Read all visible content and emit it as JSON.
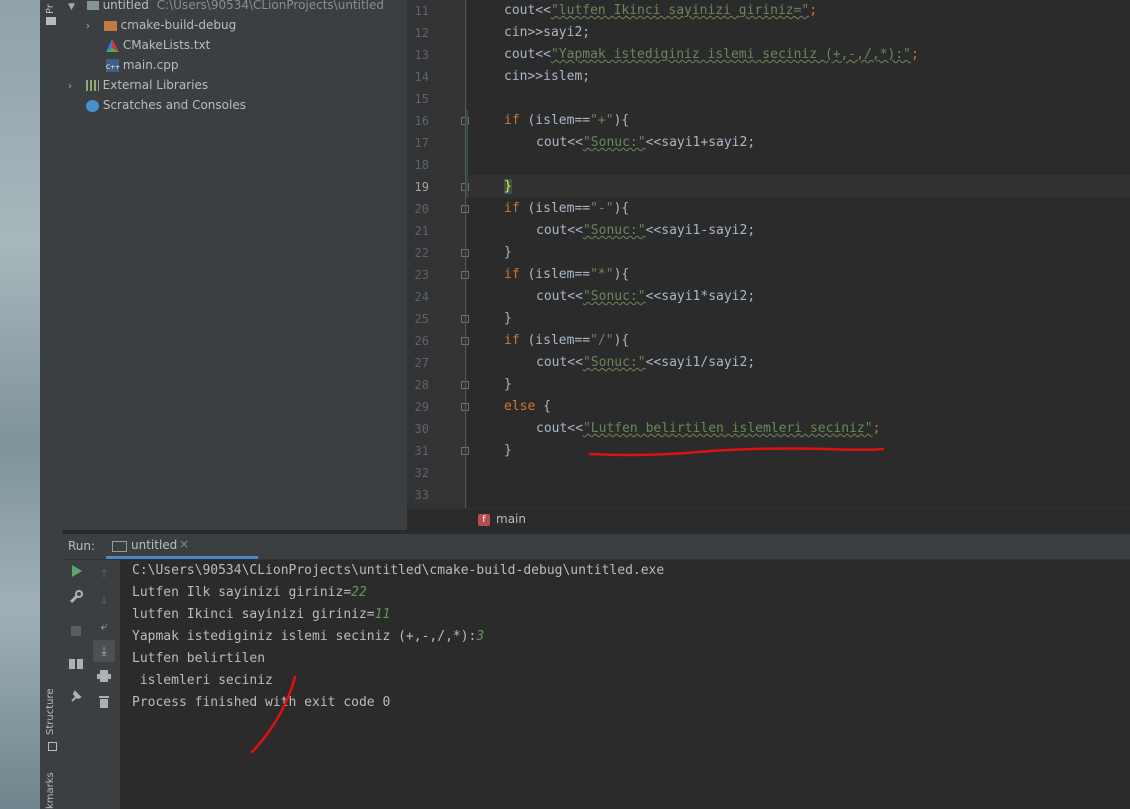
{
  "project_tree": {
    "root_name": "untitled",
    "root_path": "C:\\Users\\90534\\CLionProjects\\untitled",
    "items": [
      {
        "label": "cmake-build-debug",
        "icon": "folder-icon"
      },
      {
        "label": "CMakeLists.txt",
        "icon": "cmake-icon"
      },
      {
        "label": "main.cpp",
        "icon": "cpp-file-icon"
      },
      {
        "label": "External Libraries",
        "icon": "libraries-icon"
      },
      {
        "label": "Scratches and Consoles",
        "icon": "scratches-icon"
      }
    ]
  },
  "left_tool_strip": {
    "project_label": "Pr",
    "structure_label": "Structure",
    "bookmarks_label": "kmarks"
  },
  "editor": {
    "line_numbers": [
      "11",
      "12",
      "13",
      "14",
      "15",
      "16",
      "17",
      "18",
      "19",
      "20",
      "21",
      "22",
      "23",
      "24",
      "25",
      "26",
      "27",
      "28",
      "29",
      "30",
      "31",
      "32",
      "33"
    ],
    "current_line": "19",
    "code": {
      "l11": {
        "a": "cout<<",
        "b": "\"lutfen Ikinci sayinizi giriniz=\"",
        "c": ";"
      },
      "l12": {
        "a": "cin>>sayi2;"
      },
      "l13": {
        "a": "cout<<",
        "b": "\"Yapmak istediginiz islemi seciniz (+,-,/,*):\"",
        "c": ";"
      },
      "l14": {
        "a": "cin>>islem;"
      },
      "l16": {
        "kw": "if",
        "a": " (islem==",
        "b": "\"+\"",
        "c": "){"
      },
      "l17": {
        "a": "cout<<",
        "b": "\"Sonuc:\"",
        "c": "<<sayi1+sayi2;"
      },
      "l19": {
        "a": "}"
      },
      "l20": {
        "kw": "if",
        "a": " (islem==",
        "b": "\"-\"",
        "c": "){"
      },
      "l21": {
        "a": "cout<<",
        "b": "\"Sonuc:\"",
        "c": "<<sayi1-sayi2;"
      },
      "l22": {
        "a": "}"
      },
      "l23": {
        "kw": "if",
        "a": " (islem==",
        "b": "\"*\"",
        "c": "){"
      },
      "l24": {
        "a": "cout<<",
        "b": "\"Sonuc:\"",
        "c": "<<sayi1*sayi2;"
      },
      "l25": {
        "a": "}"
      },
      "l26": {
        "kw": "if",
        "a": " (islem==",
        "b": "\"/\"",
        "c": "){"
      },
      "l27": {
        "a": "cout<<",
        "b": "\"Sonuc:\"",
        "c": "<<sayi1/sayi2;"
      },
      "l28": {
        "a": "}"
      },
      "l29": {
        "kw": "else",
        "a": " {"
      },
      "l30": {
        "a": "cout<<",
        "b": "\"Lutfen belirtilen islemleri seciniz\"",
        "c": ";"
      },
      "l31": {
        "a": "}"
      }
    },
    "breadcrumb": {
      "badge": "f",
      "label": "main"
    }
  },
  "run_panel": {
    "run_label": "Run:",
    "tab_label": "untitled",
    "close_glyph": "×",
    "console": [
      {
        "text": "C:\\Users\\90534\\CLionProjects\\untitled\\cmake-build-debug\\untitled.exe"
      },
      {
        "text": "Lutfen Ilk sayinizi giriniz=",
        "input": "22"
      },
      {
        "text": "lutfen Ikinci sayinizi giriniz=",
        "input": "11"
      },
      {
        "text": "Yapmak istediginiz islemi seciniz (+,-,/,*):",
        "input": "3"
      },
      {
        "text": "Lutfen belirtilen"
      },
      {
        "text": " islemleri seciniz"
      },
      {
        "text": "Process finished with exit code 0"
      }
    ]
  },
  "colors": {
    "keyword": "#cc7832",
    "string": "#6a8759",
    "user_input": "#629755",
    "annotation": "#e01010"
  }
}
